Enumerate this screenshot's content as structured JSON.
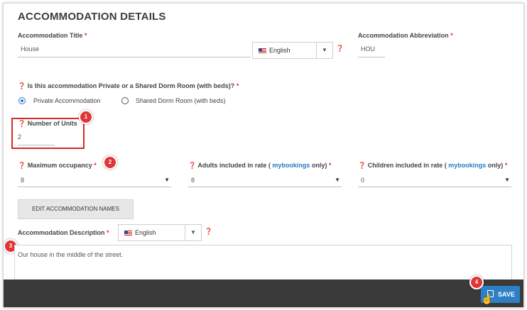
{
  "section_title": "ACCOMMODATION DETAILS",
  "title_field": {
    "label": "Accommodation Title",
    "required_mark": "*",
    "value": "House"
  },
  "title_language": {
    "value": "English"
  },
  "abbreviation_field": {
    "label": "Accommodation Abbreviation",
    "required_mark": "*",
    "value": "HOU"
  },
  "room_type_question": {
    "label": "Is this accommodation Private or a Shared Dorm Room (with beds)?",
    "required_mark": "*"
  },
  "room_type_options": [
    {
      "label": "Private Accommodation",
      "selected": true
    },
    {
      "label": "Shared Dorm Room (with beds)",
      "selected": false
    }
  ],
  "units_field": {
    "label": "Number of Units",
    "value": "2"
  },
  "max_occupancy": {
    "label": "Maximum occupancy",
    "required_mark": "*",
    "value": "8"
  },
  "adults_included": {
    "label_prefix": "Adults included in rate (",
    "link": "mybookings",
    "label_suffix": "only)",
    "required_mark": "*",
    "value": "8"
  },
  "children_included": {
    "label_prefix": "Children included in rate (",
    "link": "mybookings",
    "label_suffix": "only)",
    "required_mark": "*",
    "value": "0"
  },
  "edit_names_button": "EDIT ACCOMMODATION NAMES",
  "description_field": {
    "label": "Accommodation Description",
    "required_mark": "*",
    "value": "Our house in the middle of the street."
  },
  "description_language": {
    "value": "English"
  },
  "save_button": "SAVE",
  "callouts": [
    "1",
    "2",
    "3",
    "4"
  ],
  "colors": {
    "accent": "#2a79c4",
    "required": "#e03030",
    "callout": "#e03636",
    "footer": "#3a3a3a"
  },
  "icons": [
    "help-icon",
    "flag-icon",
    "chevron-down-icon",
    "save-icon",
    "cursor-icon"
  ]
}
